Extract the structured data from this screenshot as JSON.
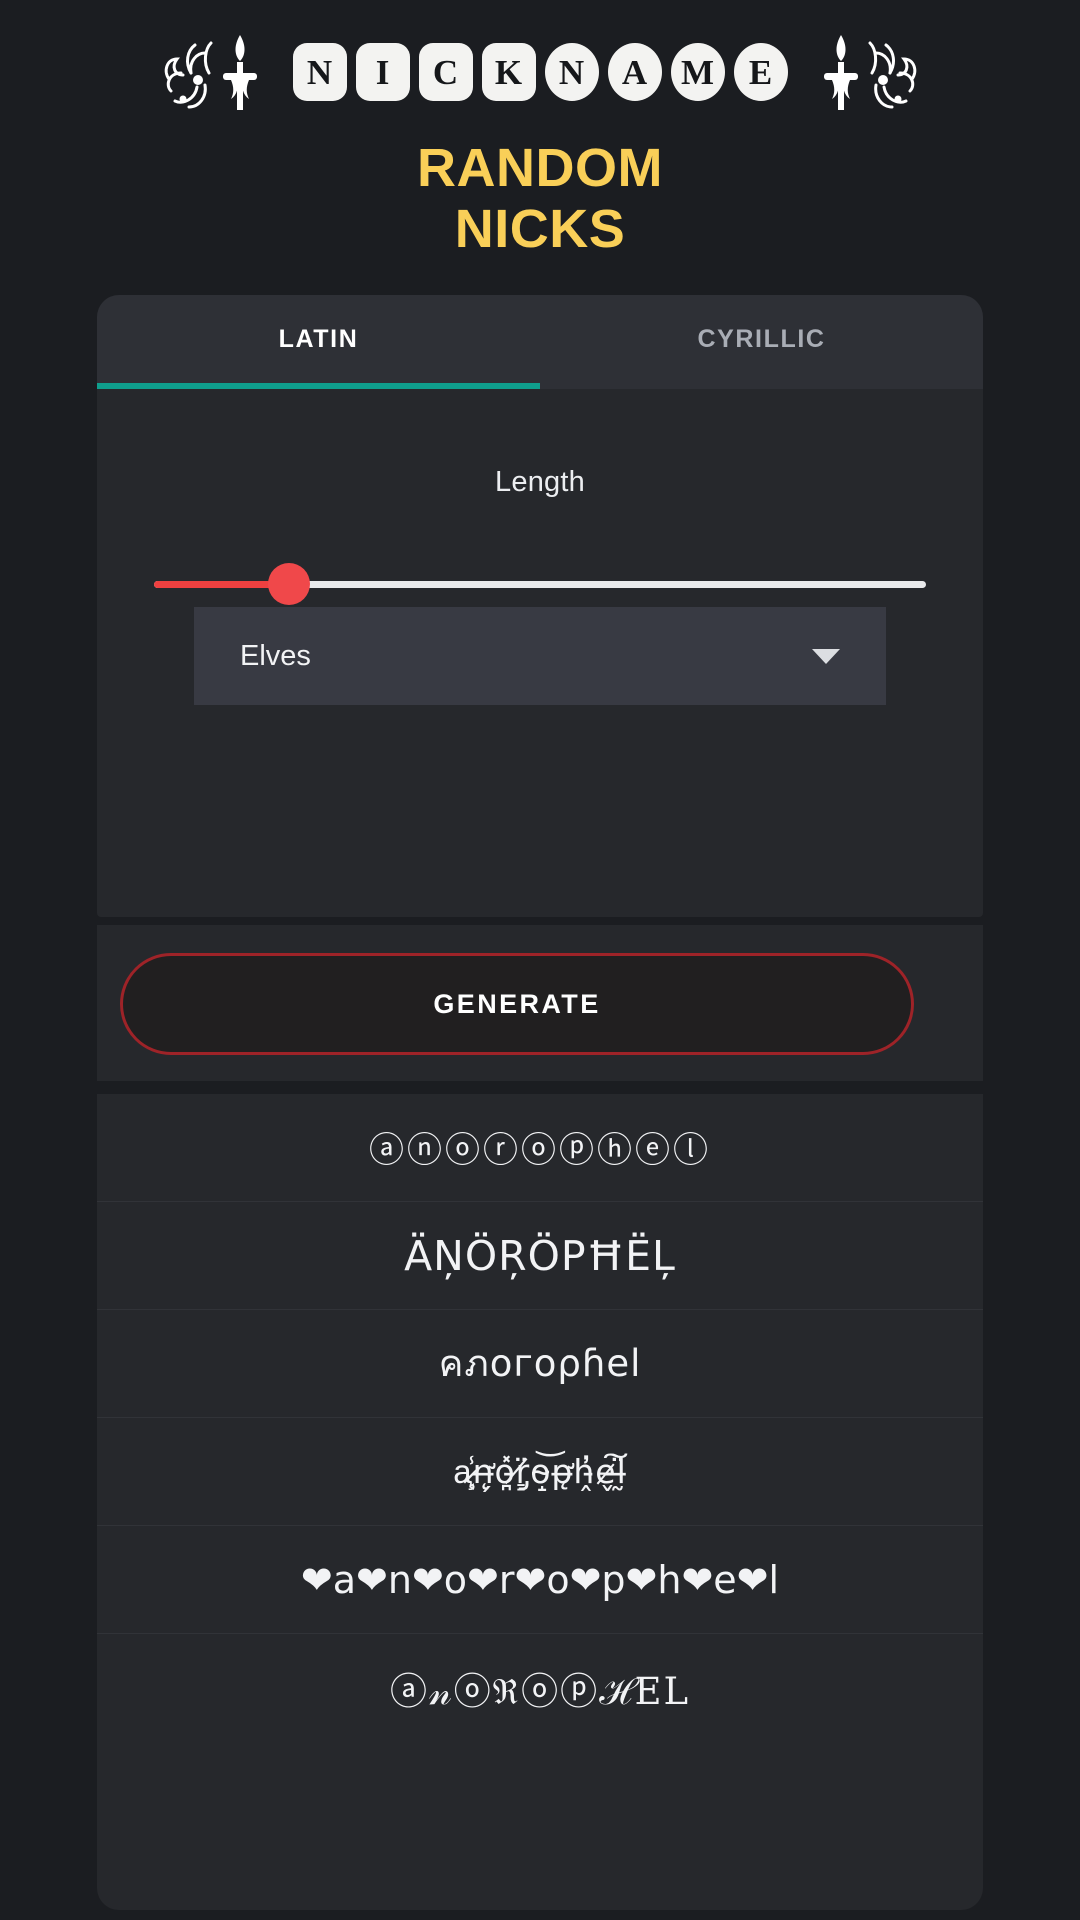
{
  "header": {
    "logo_text": "NICKNAME",
    "logo_letters": [
      "N",
      "I",
      "C",
      "K",
      "N",
      "A",
      "M",
      "E"
    ],
    "left_flourish_icon": "torch-flourish-left-icon",
    "right_flourish_icon": "torch-flourish-right-icon"
  },
  "title": {
    "line1": "RANDOM",
    "line2": "NICKS",
    "color": "#f9cf58"
  },
  "tabs": {
    "items": [
      {
        "label": "LATIN",
        "active": true
      },
      {
        "label": "CYRILLIC",
        "active": false
      }
    ],
    "indicator_color": "#0f9e8d"
  },
  "controls": {
    "length_label": "Length",
    "slider": {
      "value": "5",
      "value_color": "#f43f72",
      "fill_color": "#ee4040",
      "track_color": "#e9eaec",
      "thumb_color": "#f0484a"
    },
    "category_dropdown": {
      "value": "Elves",
      "caret_icon": "chevron-down-icon"
    }
  },
  "generate": {
    "label": "GENERATE",
    "border_color": "#9e2328"
  },
  "results": {
    "items": [
      {
        "style": "r-circled",
        "text": "ⓐⓝⓞⓡⓞⓟⓗⓔⓛ"
      },
      {
        "style": "r-diacritic",
        "text": "ÄŅÖŖÖPĦËĻ"
      },
      {
        "style": "r-mixed",
        "text": "คภoгoρɦel"
      },
      {
        "style": "r-zalgo",
        "text": "a̷̧͔̾n̶̨̛̗o̵̪̽r̸̡͇̈o̴̝͝p̶̨̛h̵̭̓e̷̬͠l̶̰̈"
      },
      {
        "style": "r-hearts",
        "text": "❤a❤n❤o❤r❤o❤p❤h❤e❤l"
      },
      {
        "style": "r-fancy",
        "text": "ⓐ𝓃ⓞℜⓞⓟℋEL"
      }
    ]
  }
}
